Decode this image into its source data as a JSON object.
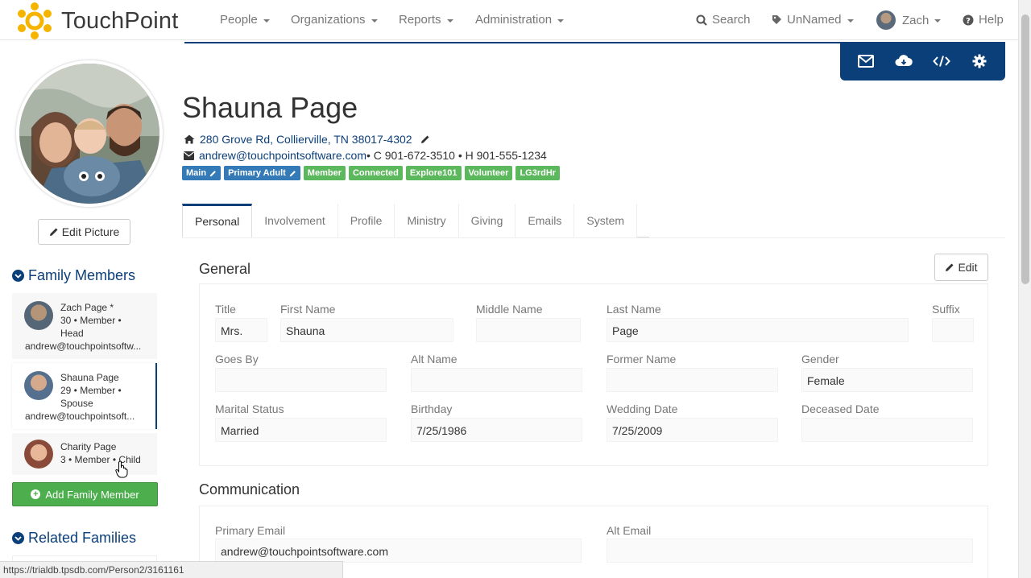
{
  "nav": {
    "brand": "TouchPoint",
    "menus": [
      "People",
      "Organizations",
      "Reports",
      "Administration"
    ],
    "search": "Search",
    "tag": "UnNamed",
    "user": "Zach",
    "help": "Help"
  },
  "toolbar": {
    "icons": [
      "envelope-icon",
      "cloud-download-icon",
      "code-icon",
      "gear-icon"
    ]
  },
  "sidebar": {
    "edit_picture": "Edit Picture",
    "family_title": "Family Members",
    "family": [
      {
        "name": "Zach Page *",
        "meta": "30 • Member •",
        "role": "Head",
        "email": "andrew@touchpointsoftw..."
      },
      {
        "name": "Shauna Page",
        "meta": "29 • Member •",
        "role": "Spouse",
        "email": "andrew@touchpointsoft..."
      },
      {
        "name": "Charity Page",
        "meta": "3 • Member • Child"
      }
    ],
    "add_family": "Add Family Member",
    "related_title": "Related Families"
  },
  "person": {
    "name": "Shauna Page",
    "address": "280 Grove Rd, Collierville, TN 38017-4302",
    "email": "andrew@touchpointsoftware.com",
    "phones": " • C 901-672-3510 • H 901-555-1234",
    "badges": [
      {
        "label": "Main",
        "color": "#337ab7",
        "editable": true
      },
      {
        "label": "Primary Adult",
        "color": "#337ab7",
        "editable": true
      },
      {
        "label": "Member",
        "color": "#5cb85c"
      },
      {
        "label": "Connected",
        "color": "#5cb85c"
      },
      {
        "label": "Explore101",
        "color": "#5cb85c"
      },
      {
        "label": "Volunteer",
        "color": "#5cb85c"
      },
      {
        "label": "LG3rdHr",
        "color": "#5cb85c"
      }
    ]
  },
  "tabs": [
    "Personal",
    "Involvement",
    "Profile",
    "Ministry",
    "Giving",
    "Emails",
    "System"
  ],
  "general": {
    "title": "General",
    "edit": "Edit",
    "labels": {
      "title": "Title",
      "first": "First Name",
      "middle": "Middle Name",
      "last": "Last Name",
      "suffix": "Suffix",
      "goesby": "Goes By",
      "alt": "Alt Name",
      "former": "Former Name",
      "gender": "Gender",
      "marital": "Marital Status",
      "birthday": "Birthday",
      "wedding": "Wedding Date",
      "deceased": "Deceased Date"
    },
    "values": {
      "title": "Mrs.",
      "first": "Shauna",
      "middle": "",
      "last": "Page",
      "suffix": "",
      "goesby": "",
      "alt": "",
      "former": "",
      "gender": "Female",
      "marital": "Married",
      "birthday": "7/25/1986",
      "wedding": "7/25/2009",
      "deceased": ""
    }
  },
  "communication": {
    "title": "Communication",
    "primary_email_label": "Primary Email",
    "primary_email": "andrew@touchpointsoftware.com",
    "alt_email_label": "Alt Email",
    "alt_email": ""
  },
  "status_url": "https://trialdb.tpsdb.com/Person2/3161161",
  "colors": {
    "accent": "#0b3f7a",
    "success": "#5cb85c",
    "primary": "#337ab7"
  }
}
